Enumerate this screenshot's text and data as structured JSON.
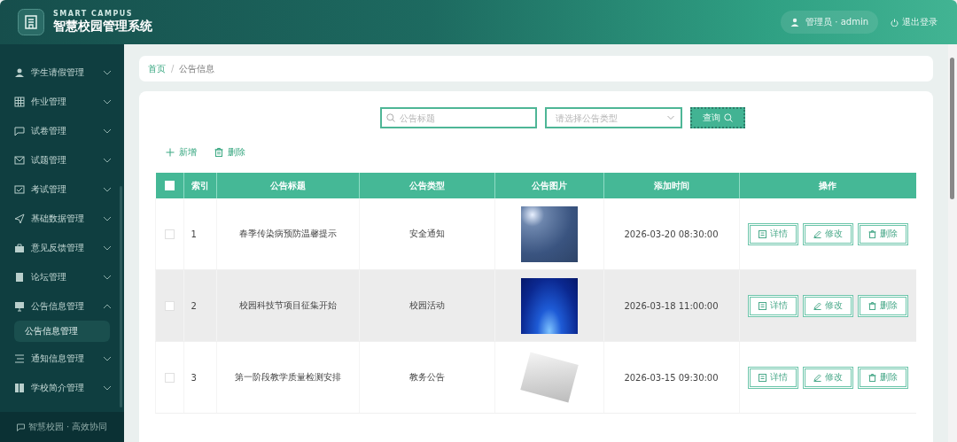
{
  "header": {
    "subtitle": "SMART CAMPUS",
    "title": "智慧校园管理系统",
    "user": "管理员 · admin",
    "logout": "退出登录"
  },
  "sidebar": {
    "items": [
      {
        "label": "学生请假管理",
        "expanded": false
      },
      {
        "label": "作业管理",
        "expanded": false
      },
      {
        "label": "试卷管理",
        "expanded": false
      },
      {
        "label": "试题管理",
        "expanded": false
      },
      {
        "label": "考试管理",
        "expanded": false
      },
      {
        "label": "基础数据管理",
        "expanded": false
      },
      {
        "label": "意见反馈管理",
        "expanded": false
      },
      {
        "label": "论坛管理",
        "expanded": false
      },
      {
        "label": "公告信息管理",
        "expanded": true,
        "children": [
          {
            "label": "公告信息管理",
            "selected": true
          }
        ]
      },
      {
        "label": "通知信息管理",
        "expanded": false
      },
      {
        "label": "学校简介管理",
        "expanded": false
      }
    ],
    "footer": "智慧校园 · 高效协同"
  },
  "breadcrumb": {
    "home": "首页",
    "separator": "/",
    "current": "公告信息"
  },
  "search": {
    "title_placeholder": "公告标题",
    "type_placeholder": "请选择公告类型",
    "button": "查询"
  },
  "actions": [
    "新增",
    "删除"
  ],
  "table": {
    "all_checked": false,
    "columns": [
      "索引",
      "公告标题",
      "公告类型",
      "公告图片",
      "添加时间",
      "操作"
    ],
    "rows": [
      {
        "checked": false,
        "index": "1",
        "title": "春季传染病预防温馨提示",
        "type": "安全通知",
        "time": "2026-03-20 08:30:00",
        "highlighted": false,
        "buttons": [
          "详情",
          "修改",
          "删除"
        ]
      },
      {
        "checked": false,
        "index": "2",
        "title": "校园科技节项目征集开始",
        "type": "校园活动",
        "time": "2026-03-18 11:00:00",
        "highlighted": true,
        "buttons": [
          "详情",
          "修改",
          "删除"
        ]
      },
      {
        "checked": false,
        "index": "3",
        "title": "第一阶段教学质量检测安排",
        "type": "教务公告",
        "time": "2026-03-15 09:30:00",
        "highlighted": false,
        "buttons": [
          "详情",
          "修改",
          "删除"
        ]
      }
    ]
  }
}
